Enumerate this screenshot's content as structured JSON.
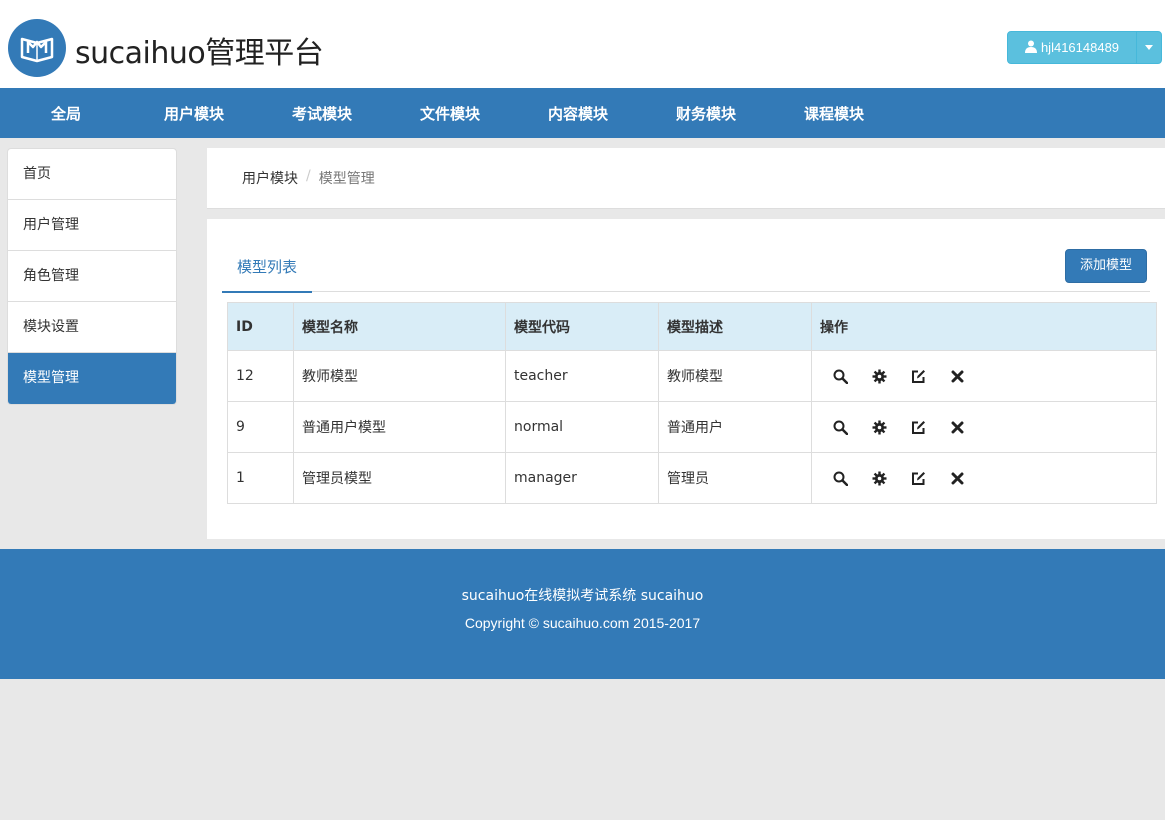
{
  "header": {
    "brand": "sucaihuo管理平台",
    "user": "hjl416148489"
  },
  "topnav": [
    "全局",
    "用户模块",
    "考试模块",
    "文件模块",
    "内容模块",
    "财务模块",
    "课程模块"
  ],
  "sidebar": [
    "首页",
    "用户管理",
    "角色管理",
    "模块设置",
    "模型管理"
  ],
  "breadcrumb": {
    "parent": "用户模块",
    "sep": "/",
    "current": "模型管理"
  },
  "panel": {
    "tab": "模型列表",
    "add_button": "添加模型"
  },
  "table": {
    "headers": [
      "ID",
      "模型名称",
      "模型代码",
      "模型描述",
      "操作"
    ],
    "rows": [
      {
        "id": "12",
        "name": "教师模型",
        "code": "teacher",
        "desc": "教师模型"
      },
      {
        "id": "9",
        "name": "普通用户模型",
        "code": "normal",
        "desc": "普通用户"
      },
      {
        "id": "1",
        "name": "管理员模型",
        "code": "manager",
        "desc": "管理员"
      }
    ],
    "actions": [
      "search-icon",
      "cog-icon",
      "edit-icon",
      "remove-icon"
    ]
  },
  "footer": {
    "line1": "sucaihuo在线模拟考试系统 sucaihuo",
    "line2": "Copyright © sucaihuo.com 2015-2017"
  },
  "colors": {
    "primary": "#337ab7",
    "info": "#5bc0de",
    "table_head": "#d9edf7",
    "bg": "#e8e8e8"
  }
}
